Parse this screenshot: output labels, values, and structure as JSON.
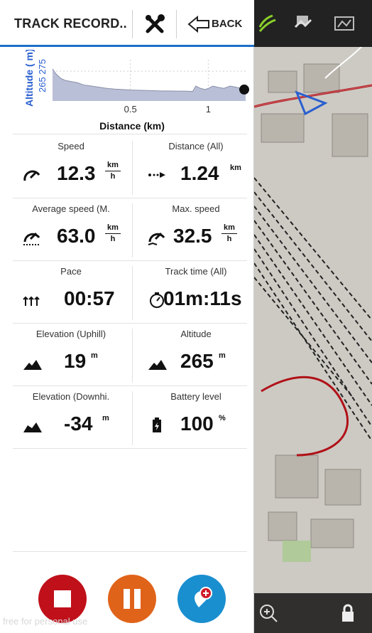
{
  "header": {
    "title": "TRACK RECORD..",
    "back_label": "BACK"
  },
  "chart_data": {
    "type": "area",
    "ylabel": "Altitude ( m)",
    "xlabel": "Distance (km)",
    "yticks": [
      "265",
      "275"
    ],
    "xticks": [
      0.5,
      1
    ],
    "xlim": [
      0,
      1.24
    ],
    "ylim": [
      262,
      280
    ],
    "x": [
      0,
      0.02,
      0.05,
      0.08,
      0.12,
      0.16,
      0.2,
      0.25,
      0.3,
      0.35,
      0.4,
      0.45,
      0.5,
      0.55,
      0.6,
      0.65,
      0.7,
      0.75,
      0.8,
      0.85,
      0.9,
      0.92,
      0.95,
      0.98,
      1.0,
      1.03,
      1.06,
      1.1,
      1.14,
      1.18,
      1.21,
      1.24
    ],
    "y": [
      276,
      274,
      272,
      271,
      270.5,
      270,
      269,
      268.5,
      268,
      267.5,
      267.2,
      267,
      266.8,
      266.7,
      266.6,
      266.5,
      266.4,
      266.4,
      266.3,
      266.3,
      266.2,
      268.5,
      267.5,
      267,
      267.5,
      268.5,
      268,
      267.5,
      268.5,
      268,
      267.5,
      267
    ],
    "fill_color": "#b9bfd6",
    "line_color": "#8a90a8",
    "end_marker_color": "#111111"
  },
  "stats": [
    {
      "caption": "Speed",
      "value": "12.3",
      "unit_top": "km",
      "unit_bottom": "h",
      "icon": "speedometer-icon"
    },
    {
      "caption": "Distance (All)",
      "value": "1.24",
      "unit": "km",
      "icon": "distance-icon"
    },
    {
      "caption": "Average speed (M.",
      "value": "63.0",
      "unit_top": "km",
      "unit_bottom": "h",
      "icon": "average-speed-icon"
    },
    {
      "caption": "Max. speed",
      "value": "32.5",
      "unit_top": "km",
      "unit_bottom": "h",
      "icon": "max-speed-icon"
    },
    {
      "caption": "Pace",
      "value": "00:57",
      "icon": "pace-icon"
    },
    {
      "caption": "Track time (All)",
      "value": "01m:11s",
      "icon": "stopwatch-icon"
    },
    {
      "caption": "Elevation (Uphill)",
      "value": "19",
      "unit": "m",
      "icon": "uphill-icon"
    },
    {
      "caption": "Altitude",
      "value": "265",
      "unit": "m",
      "icon": "mountain-icon"
    },
    {
      "caption": "Elevation (Downhi.",
      "value": "-34",
      "unit": "m",
      "icon": "downhill-icon"
    },
    {
      "caption": "Battery level",
      "value": "100",
      "unit": "%",
      "icon": "battery-icon"
    }
  ],
  "controls": {
    "stop_color": "#c0101a",
    "pause_color": "#e0631a",
    "waypoint_color": "#1a8fd0"
  },
  "watermark": "free for personal use",
  "colors": {
    "accent": "#1f6fc7",
    "map_bg": "#c9c6c1"
  }
}
